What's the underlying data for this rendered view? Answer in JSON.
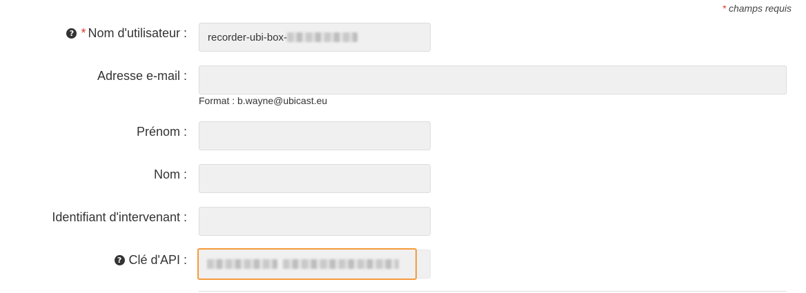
{
  "header": {
    "required_star": "*",
    "required_note": "champs requis"
  },
  "fields": {
    "username": {
      "star": "*",
      "label": "Nom d'utilisateur :",
      "value": "recorder-ubi-box-"
    },
    "email": {
      "label": "Adresse e-mail :",
      "value": "",
      "hint": "Format : b.wayne@ubicast.eu"
    },
    "first_name": {
      "label": "Prénom :",
      "value": ""
    },
    "last_name": {
      "label": "Nom :",
      "value": ""
    },
    "speaker_id": {
      "label": "Identifiant d'intervenant :",
      "value": ""
    },
    "api_key": {
      "label": "Clé d'API :",
      "value": ""
    }
  },
  "icons": {
    "help": "question-circle-icon",
    "help_glyph": "?"
  },
  "colors": {
    "required": "#e0392b",
    "focus_border": "#f59a3a",
    "field_bg": "#f0f0f0"
  }
}
